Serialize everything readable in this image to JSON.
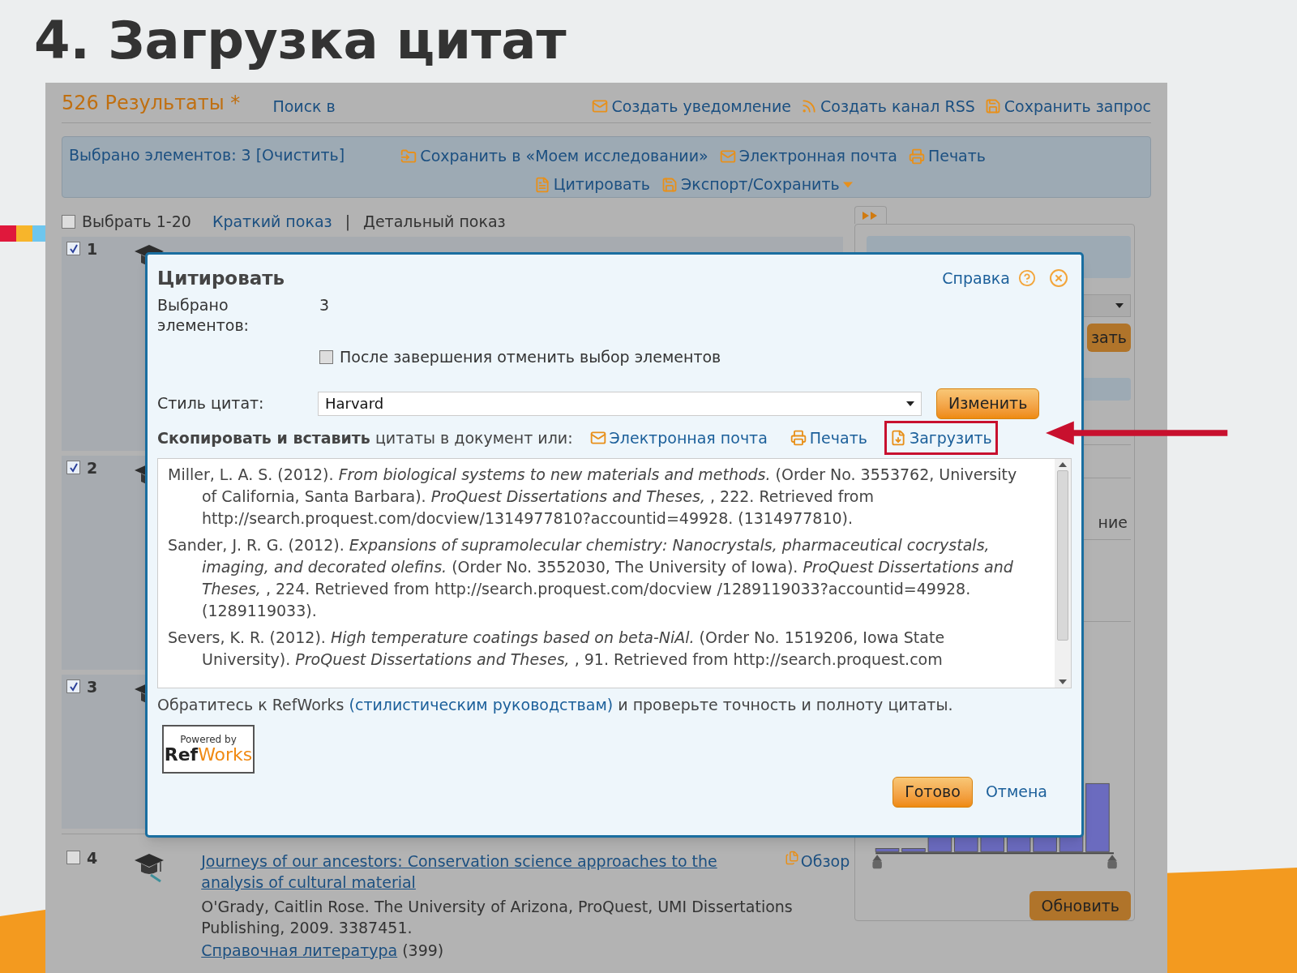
{
  "slide_title": "4. Загрузка цитат",
  "results_header": {
    "count": "526 Результаты *",
    "search_in": "Поиск в",
    "actions": [
      {
        "label": "Создать уведомление"
      },
      {
        "label": "Создать канал RSS"
      },
      {
        "label": "Сохранить запрос"
      }
    ]
  },
  "selection_bar": {
    "selected": "Выбрано элементов: 3 [Очистить]",
    "actions": [
      {
        "label": "Сохранить в «Моем исследовании»",
        "dropdown": false
      },
      {
        "label": "Электронная почта",
        "dropdown": false
      },
      {
        "label": "Печать",
        "dropdown": false
      },
      {
        "label": "Цитировать",
        "dropdown": false
      },
      {
        "label": "Экспорт/Сохранить",
        "dropdown": true
      }
    ]
  },
  "view_bar": {
    "select_all": {
      "label": "Выбрать 1-20",
      "checked": false
    },
    "views": [
      "Краткий показ",
      "Детальный показ"
    ],
    "separator": "|"
  },
  "results": [
    {
      "number": "1",
      "checked": true
    },
    {
      "number": "2",
      "checked": true
    },
    {
      "number": "3",
      "checked": true
    },
    {
      "number": "4",
      "checked": false,
      "title": "Journeys of our ancestors: Conservation science approaches to the analysis of cultural material",
      "preview": "Обзор",
      "details": "O'Grady, Caitlin Rose. The University of Arizona, ProQuest, UMI Dissertations Publishing, 2009. 3387451.",
      "references": "Справочная литература",
      "references_count": "(399)"
    }
  ],
  "sidebar": {
    "partial_button": "зать",
    "partial_label": "ние",
    "refresh_button": "Обновить"
  },
  "dialog": {
    "title": "Цитировать",
    "help": "Справка",
    "selected_label": "Выбрано элементов:",
    "selected_value": "3",
    "deselect": {
      "label": "После завершения отменить выбор элементов",
      "checked": false
    },
    "style_label": "Стиль цитат:",
    "style_value": "Harvard",
    "change_button": "Изменить",
    "copy_text": "**Скопировать и вставить** цитаты в документ или:",
    "export_links": [
      {
        "label": "Электронная почта",
        "highlighted": false
      },
      {
        "label": "Печать",
        "highlighted": false
      },
      {
        "label": "Загрузить",
        "highlighted": true
      }
    ],
    "citations": [
      "Miller, L. A. S. (2012). *From biological systems to new materials and methods.* (Order No. 3553762, University of California, Santa Barbara). *ProQuest Dissertations and Theses,* , 222. Retrieved from http://search.proquest.com/docview/1314977810?accountid=49928. (1314977810).",
      "Sander, J. R. G. (2012). *Expansions of supramolecular chemistry: Nanocrystals, pharmaceutical cocrystals, imaging, and decorated olefins.* (Order No. 3552030, The University of Iowa). *ProQuest Dissertations and Theses,* , 224. Retrieved from http://search.proquest.com/docview /1289119033?accountid=49928. (1289119033).",
      "Severs, K. R. (2012). *High temperature coatings based on beta-NiAl.* (Order No. 1519206, Iowa State University). *ProQuest Dissertations and Theses,* , 91. Retrieved from http://search.proquest.com"
    ],
    "note_before": "Обратитесь к RefWorks",
    "note_link": "(стилистическим руководствам)",
    "note_after": "и проверьте точность и полноту цитаты.",
    "logo": {
      "powered_by": "Powered by",
      "ref": "Ref",
      "works": "Works"
    },
    "done_button": "Готово",
    "cancel": "Отмена"
  }
}
